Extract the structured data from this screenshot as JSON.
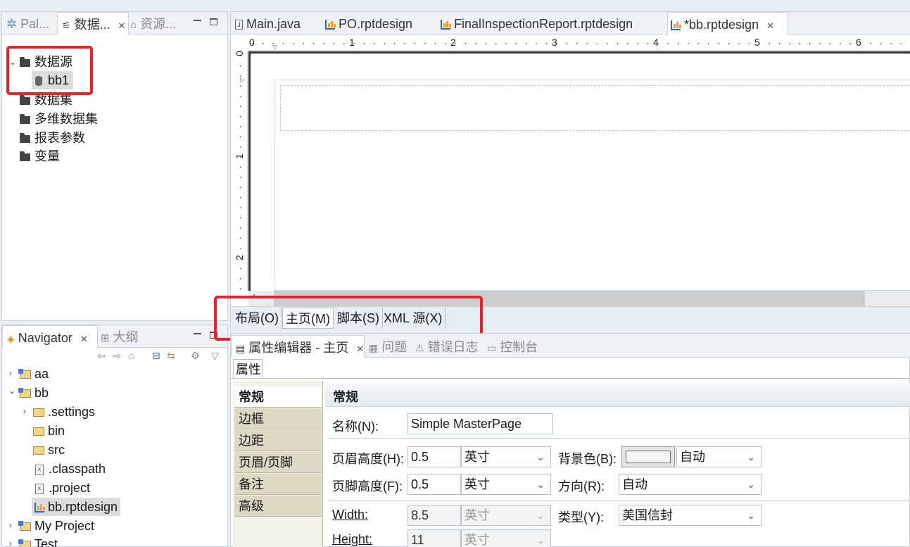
{
  "left_top_panel": {
    "tabs": [
      {
        "label": "Pal..."
      },
      {
        "label": "数据..."
      },
      {
        "label": "资源..."
      }
    ],
    "tree": {
      "root": "数据源",
      "child": "bb1",
      "items": [
        "数据集",
        "多维数据集",
        "报表参数",
        "变量"
      ]
    }
  },
  "navigator": {
    "tabs": [
      {
        "label": "Navigator"
      },
      {
        "label": "大纲"
      }
    ],
    "tree": {
      "aa": "aa",
      "bb": "bb",
      "settings": ".settings",
      "bin": "bin",
      "src": "src",
      "classpath": ".classpath",
      "project": ".project",
      "rptdesign": "bb.rptdesign",
      "my_project": "My Project",
      "test": "Test"
    }
  },
  "editor": {
    "tabs": [
      {
        "label": "Main.java"
      },
      {
        "label": "PO.rptdesign"
      },
      {
        "label": "FinalInspectionReport.rptdesign"
      },
      {
        "label": "*bb.rptdesign"
      }
    ],
    "ruler_numbers": [
      "0",
      "1",
      "2",
      "3",
      "4",
      "5",
      "6"
    ],
    "vruler_numbers": [
      "0",
      "1",
      "2"
    ],
    "bottom_tabs": [
      {
        "label": "布局(O)"
      },
      {
        "label": "主页(M)"
      },
      {
        "label": "脚本(S)"
      },
      {
        "label": "XML 源(X)"
      }
    ]
  },
  "bottom_panel": {
    "tabs": [
      {
        "label": "属性编辑器 - 主页"
      },
      {
        "label": "问题"
      },
      {
        "label": "错误日志"
      },
      {
        "label": "控制台"
      }
    ],
    "sub_tab": "属性",
    "categories": [
      "常规",
      "边框",
      "边距",
      "页眉/页脚",
      "备注",
      "高级"
    ],
    "section_title": "常规",
    "fields": {
      "name_label": "名称(N):",
      "name_value": "Simple MasterPage",
      "header_height_label": "页眉高度(H):",
      "header_height_value": "0.5",
      "header_height_unit": "英寸",
      "footer_height_label": "页脚高度(F):",
      "footer_height_value": "0.5",
      "footer_height_unit": "英寸",
      "bgcolor_label": "背景色(B):",
      "bgcolor_value": "自动",
      "orientation_label": "方向(R):",
      "orientation_value": "自动",
      "width_label": "Width:",
      "width_value": "8.5",
      "width_unit": "英寸",
      "type_label": "类型(Y):",
      "type_value": "美国信封",
      "height_label": "Height:",
      "height_value": "11",
      "height_unit": "英寸"
    }
  },
  "colors": {
    "highlight_box": "#e8232a",
    "accent_blue": "#2a67c4"
  }
}
